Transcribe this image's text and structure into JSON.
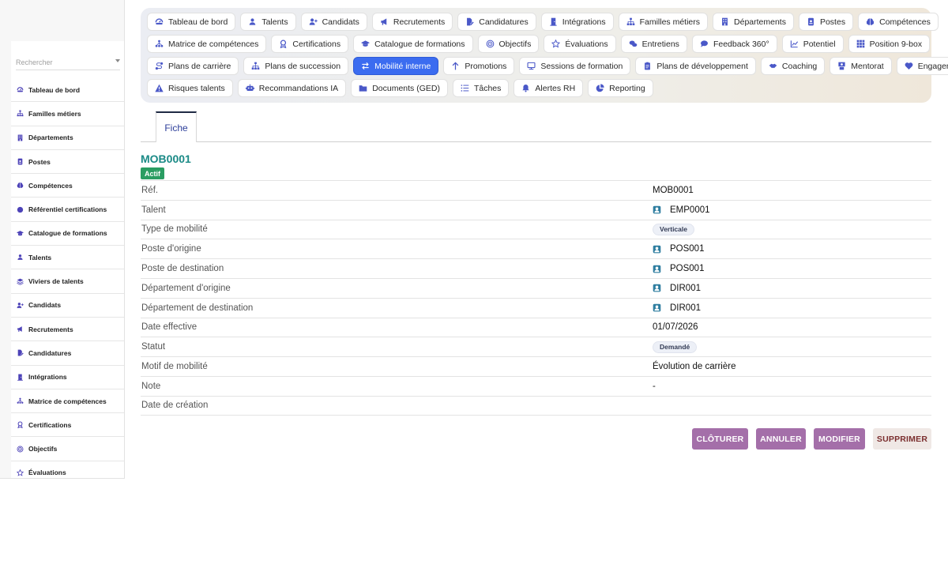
{
  "sidebar": {
    "search_placeholder": "Rechercher",
    "items": [
      {
        "label": "Tableau de bord",
        "icon": "dashboard-icon"
      },
      {
        "label": "Familles métiers",
        "icon": "sitemap-icon"
      },
      {
        "label": "Départements",
        "icon": "building-icon"
      },
      {
        "label": "Postes",
        "icon": "id-badge-icon"
      },
      {
        "label": "Compétences",
        "icon": "brain-icon"
      },
      {
        "label": "Référentiel certifications",
        "icon": "certificate-icon"
      },
      {
        "label": "Catalogue de formations",
        "icon": "graduation-cap-icon"
      },
      {
        "label": "Talents",
        "icon": "user-icon"
      },
      {
        "label": "Viviers de talents",
        "icon": "layers-icon"
      },
      {
        "label": "Candidats",
        "icon": "user-plus-icon"
      },
      {
        "label": "Recrutements",
        "icon": "megaphone-icon"
      },
      {
        "label": "Candidatures",
        "icon": "file-signature-icon"
      },
      {
        "label": "Intégrations",
        "icon": "door-icon"
      },
      {
        "label": "Matrice de compétences",
        "icon": "network-icon"
      },
      {
        "label": "Certifications",
        "icon": "award-icon"
      },
      {
        "label": "Objectifs",
        "icon": "target-icon"
      },
      {
        "label": "Évaluations",
        "icon": "star-icon"
      }
    ]
  },
  "topnav": {
    "rows": [
      [
        {
          "label": "Tableau de bord",
          "icon": "dashboard-icon"
        },
        {
          "label": "Talents",
          "icon": "user-icon"
        },
        {
          "label": "Candidats",
          "icon": "user-plus-icon"
        },
        {
          "label": "Recrutements",
          "icon": "megaphone-icon"
        },
        {
          "label": "Candidatures",
          "icon": "file-signature-icon"
        },
        {
          "label": "Intégrations",
          "icon": "door-icon"
        },
        {
          "label": "Familles métiers",
          "icon": "sitemap-icon"
        },
        {
          "label": "Départements",
          "icon": "building-icon"
        },
        {
          "label": "Postes",
          "icon": "id-badge-icon"
        },
        {
          "label": "Compétences",
          "icon": "brain-icon"
        }
      ],
      [
        {
          "label": "Matrice de compétences",
          "icon": "network-icon"
        },
        {
          "label": "Certifications",
          "icon": "award-icon"
        },
        {
          "label": "Catalogue de formations",
          "icon": "graduation-cap-icon"
        },
        {
          "label": "Objectifs",
          "icon": "target-icon"
        },
        {
          "label": "Évaluations",
          "icon": "star-icon"
        },
        {
          "label": "Entretiens",
          "icon": "comments-icon"
        },
        {
          "label": "Feedback 360°",
          "icon": "comment-icon"
        },
        {
          "label": "Potentiel",
          "icon": "chart-line-icon"
        },
        {
          "label": "Position 9-box",
          "icon": "grid-icon"
        }
      ],
      [
        {
          "label": "Plans de carrière",
          "icon": "route-icon"
        },
        {
          "label": "Plans de succession",
          "icon": "sitemap-icon"
        },
        {
          "label": "Mobilité interne",
          "icon": "exchange-icon",
          "active": true
        },
        {
          "label": "Promotions",
          "icon": "arrow-up-icon"
        },
        {
          "label": "Sessions de formation",
          "icon": "chalkboard-icon"
        },
        {
          "label": "Plans de développement",
          "icon": "clipboard-icon"
        },
        {
          "label": "Coaching",
          "icon": "handshake-icon"
        },
        {
          "label": "Mentorat",
          "icon": "mentor-icon"
        },
        {
          "label": "Engagement",
          "icon": "heart-icon"
        }
      ],
      [
        {
          "label": "Risques talents",
          "icon": "warning-icon"
        },
        {
          "label": "Recommandations IA",
          "icon": "robot-icon"
        },
        {
          "label": "Documents (GED)",
          "icon": "folder-icon"
        },
        {
          "label": "Tâches",
          "icon": "list-icon"
        },
        {
          "label": "Alertes RH",
          "icon": "bell-icon"
        },
        {
          "label": "Reporting",
          "icon": "pie-chart-icon"
        }
      ]
    ]
  },
  "tabs": [
    {
      "label": "Fiche"
    }
  ],
  "record": {
    "title": "MOB0001",
    "status": "Actif",
    "fields": [
      {
        "label": "Réf.",
        "value": "MOB0001",
        "kind": "text"
      },
      {
        "label": "Talent",
        "value": "EMP0001",
        "kind": "link"
      },
      {
        "label": "Type de mobilité",
        "value": "Verticale",
        "kind": "pill"
      },
      {
        "label": "Poste d'origine",
        "value": "POS001",
        "kind": "link"
      },
      {
        "label": "Poste de destination",
        "value": "POS001",
        "kind": "link"
      },
      {
        "label": "Département d'origine",
        "value": "DIR001",
        "kind": "link"
      },
      {
        "label": "Département de destination",
        "value": "DIR001",
        "kind": "link"
      },
      {
        "label": "Date effective",
        "value": "01/07/2026",
        "kind": "text"
      },
      {
        "label": "Statut",
        "value": "Demandé",
        "kind": "pill"
      },
      {
        "label": "Motif de mobilité",
        "value": "Évolution de carrière",
        "kind": "text"
      },
      {
        "label": "Note",
        "value": "-",
        "kind": "dash"
      },
      {
        "label": "Date de création",
        "value": "",
        "kind": "text"
      }
    ]
  },
  "actions": {
    "close_label": "CLÔTURER",
    "cancel_label": "ANNULER",
    "edit_label": "MODIFIER",
    "delete_label": "SUPPRIMER"
  },
  "colors": {
    "accent": "#3b6cf0",
    "title": "#1a8a86",
    "status_ok": "#2a9d62",
    "action_purple": "#a46fa9",
    "action_danger_bg": "#efe8e5",
    "action_danger_text": "#7a2e2e"
  }
}
